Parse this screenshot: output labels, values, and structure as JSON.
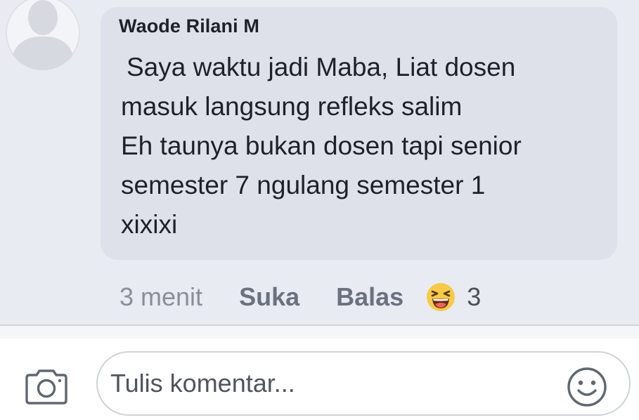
{
  "comment": {
    "author": "Waode Rilani M",
    "text_lines": [
      "Saya waktu jadi Maba, Liat dosen",
      "masuk langsung refleks salim",
      "Eh taunya bukan dosen tapi senior",
      "semester 7 ngulang semester 1",
      "xixixi"
    ],
    "timestamp": "3 menit",
    "like_label": "Suka",
    "reply_label": "Balas",
    "reaction": {
      "icon": "laughing-emoji-icon",
      "count": "3"
    }
  },
  "composer": {
    "placeholder": "Tulis komentar...",
    "value": "",
    "camera_icon": "camera-icon",
    "emoji_icon": "smiley-face-icon"
  },
  "colors": {
    "background": "#e9ebf2",
    "bubble": "#dee1e9",
    "text": "#1d2129",
    "muted": "#8a8e97",
    "action": "#6b7180",
    "emoji_yellow": "#f7c948"
  }
}
